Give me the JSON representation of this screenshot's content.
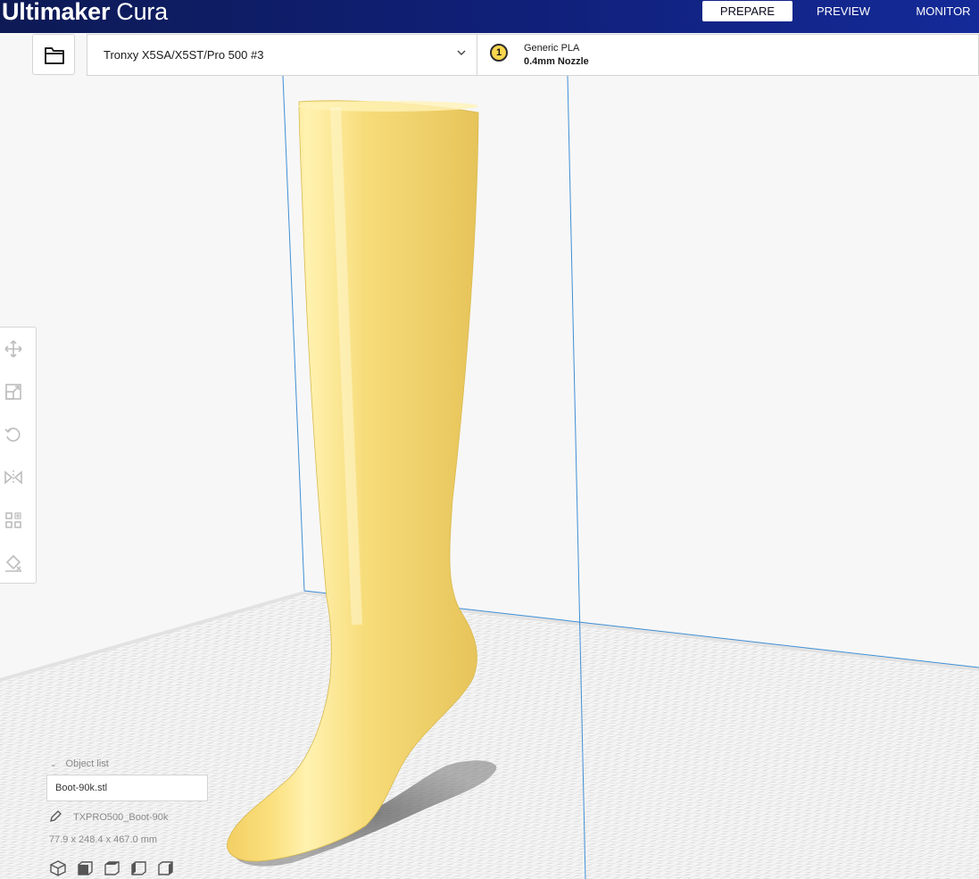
{
  "app": {
    "brand_bold": "Ultimaker",
    "brand_light": "Cura"
  },
  "stages": [
    {
      "label": "PREPARE",
      "active": true
    },
    {
      "label": "PREVIEW",
      "active": false
    },
    {
      "label": "MONITOR",
      "active": false
    }
  ],
  "printer": {
    "name": "Tronxy X5SA/X5ST/Pro 500 #3"
  },
  "extruder": {
    "number": "1",
    "material": "Generic PLA",
    "nozzle": "0.4mm Nozzle",
    "color": "#f8d64e"
  },
  "model": {
    "color": "#f8e07a"
  },
  "toolbar": {
    "tools": [
      "move-icon",
      "scale-icon",
      "rotate-icon",
      "mirror-icon",
      "per-model-settings-icon",
      "support-blocker-icon"
    ]
  },
  "object_list": {
    "toggle_label": "Object list",
    "items": [
      "Boot-90k.stl"
    ],
    "job_name": "TXPRO500_Boot-90k",
    "dimensions": "77.9 x 248.4 x 467.0 mm"
  },
  "view_buttons": [
    "3d-view-icon",
    "front-view-icon",
    "top-view-icon",
    "left-view-icon",
    "right-view-icon"
  ]
}
